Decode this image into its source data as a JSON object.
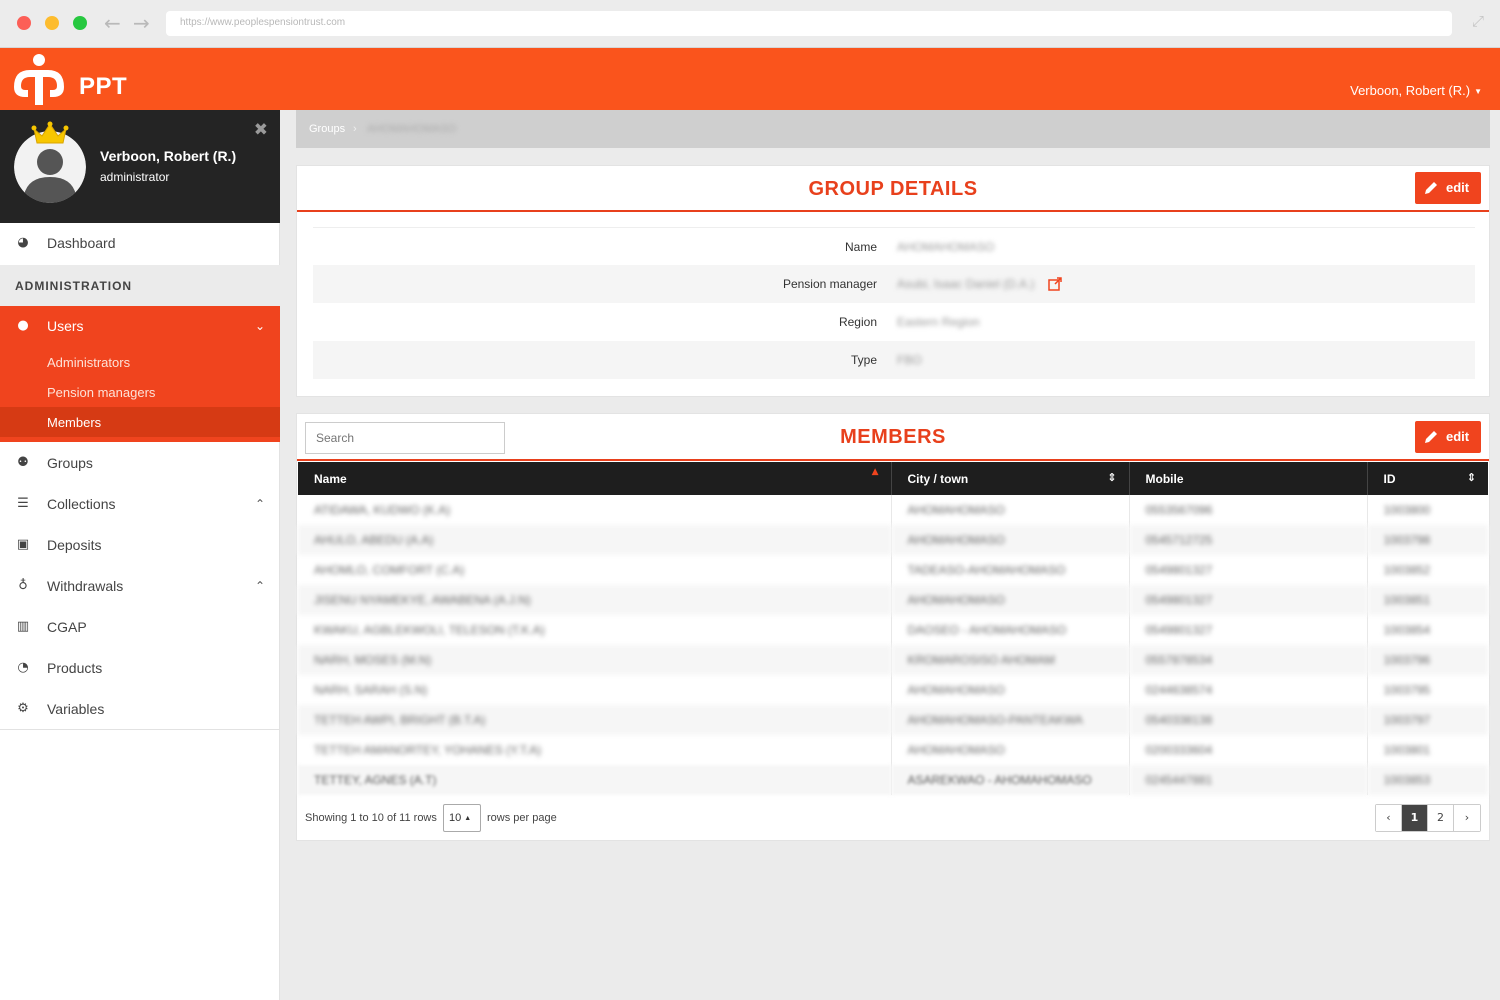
{
  "browser": {
    "url": "https://www.peoplespensiontrust.com"
  },
  "header": {
    "brand": "PPT",
    "user_menu": "Verboon, Robert (R.)"
  },
  "sidebar": {
    "profile": {
      "name": "Verboon, Robert (R.)",
      "role": "administrator"
    },
    "dashboard": "Dashboard",
    "section_title": "ADMINISTRATION",
    "users": {
      "label": "Users",
      "sub": [
        "Administrators",
        "Pension managers",
        "Members"
      ]
    },
    "items": [
      "Groups",
      "Collections",
      "Deposits",
      "Withdrawals",
      "CGAP",
      "Products",
      "Variables"
    ]
  },
  "breadcrumb": {
    "root": "Groups",
    "current": "AHOMAHOMASO"
  },
  "group_details": {
    "title": "GROUP DETAILS",
    "edit_label": "edit",
    "rows": [
      {
        "label": "Name",
        "value": "AHOMAHOMASO"
      },
      {
        "label": "Pension manager",
        "value": "Asubi, Isaac Daniel (D.A.)"
      },
      {
        "label": "Region",
        "value": "Eastern Region"
      },
      {
        "label": "Type",
        "value": "FBO"
      }
    ]
  },
  "members": {
    "title": "MEMBERS",
    "edit_label": "edit",
    "search_placeholder": "Search",
    "columns": [
      "Name",
      "City / town",
      "Mobile",
      "ID"
    ],
    "rows": [
      [
        "ATIDAWA, KUDWO (K.A)",
        "AHOMAHOMASO",
        "0553567096",
        "1003800"
      ],
      [
        "AHULO, ABEDU (A.A)",
        "AHOMAHOMASO",
        "0545712725",
        "1003798"
      ],
      [
        "AHOMLO, COMFORT (C.A)",
        "TADEASO-AHOMAHOMASO",
        "0549801327",
        "1003852"
      ],
      [
        "JISENU NYAMEKYE, AWABENA (A.J.N)",
        "AHOMAHOMASO",
        "0549801327",
        "1003851"
      ],
      [
        "KWAKU, AGBLEKWOLI, TELESON (T.K.A)",
        "DAOSEO - AHOMAHOMASO",
        "0549801327",
        "1003854"
      ],
      [
        "NARH, MOSES (M.N)",
        "KROMAROSISO AHOMAM",
        "0557878534",
        "1003796"
      ],
      [
        "NARH, SARAH (S.N)",
        "AHOMAHOMASO",
        "0244638574",
        "1003795"
      ],
      [
        "TETTEH AWPI, BRIGHT (B.T.A)",
        "AHOMAHOMASO-PANTEAKWA",
        "0540338138",
        "1003797"
      ],
      [
        "TETTEH AMANORTEY, YOHANES (Y.T.A)",
        "AHOMAHOMASO",
        "0200333604",
        "1003801"
      ],
      [
        "TETTEY, AGNES (A.T)",
        "ASAREKWAO - AHOMAHOMASO",
        "0245447881",
        "1003853"
      ]
    ],
    "footer": {
      "showing": "Showing 1 to 10 of 11 rows",
      "per_page": "10",
      "per_page_label": "rows per page",
      "pages": [
        "‹",
        "1",
        "2",
        "›"
      ],
      "current_page": "1"
    }
  },
  "colors": {
    "brand_orange": "#fa541c",
    "accent_red": "#e8401c",
    "dark": "#242424"
  }
}
